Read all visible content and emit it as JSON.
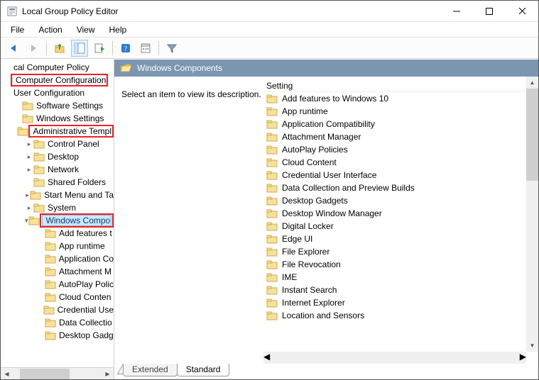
{
  "window": {
    "title": "Local Group Policy Editor"
  },
  "menus": [
    "File",
    "Action",
    "View",
    "Help"
  ],
  "toolbar_icons": [
    "back",
    "forward",
    "sep",
    "up",
    "treeview",
    "export",
    "sep",
    "help",
    "props",
    "sep",
    "filter"
  ],
  "tree": [
    {
      "indent": 0,
      "twist": "",
      "icon": "none",
      "label": "cal Computer Policy",
      "hl": false,
      "sel": false
    },
    {
      "indent": 0,
      "twist": "",
      "icon": "none",
      "label": "Computer Configuration",
      "hl": true,
      "sel": false
    },
    {
      "indent": 0,
      "twist": "",
      "icon": "none",
      "label": "User Configuration",
      "hl": false,
      "sel": false
    },
    {
      "indent": 1,
      "twist": "",
      "icon": "folder",
      "label": "Software Settings",
      "hl": false,
      "sel": false
    },
    {
      "indent": 1,
      "twist": "",
      "icon": "folder",
      "label": "Windows Settings",
      "hl": false,
      "sel": false
    },
    {
      "indent": 1,
      "twist": "",
      "icon": "folder",
      "label": "Administrative Templ",
      "hl": true,
      "sel": false
    },
    {
      "indent": 2,
      "twist": ">",
      "icon": "folder",
      "label": "Control Panel",
      "hl": false,
      "sel": false
    },
    {
      "indent": 2,
      "twist": ">",
      "icon": "folder",
      "label": "Desktop",
      "hl": false,
      "sel": false
    },
    {
      "indent": 2,
      "twist": ">",
      "icon": "folder",
      "label": "Network",
      "hl": false,
      "sel": false
    },
    {
      "indent": 2,
      "twist": "",
      "icon": "folder",
      "label": "Shared Folders",
      "hl": false,
      "sel": false
    },
    {
      "indent": 2,
      "twist": ">",
      "icon": "folder",
      "label": "Start Menu and Ta",
      "hl": false,
      "sel": false
    },
    {
      "indent": 2,
      "twist": ">",
      "icon": "folder",
      "label": "System",
      "hl": false,
      "sel": false
    },
    {
      "indent": 2,
      "twist": "v",
      "icon": "folder",
      "label": "Windows Compo",
      "hl": true,
      "sel": true
    },
    {
      "indent": 3,
      "twist": "",
      "icon": "folder",
      "label": "Add features t",
      "hl": false,
      "sel": false
    },
    {
      "indent": 3,
      "twist": "",
      "icon": "folder",
      "label": "App runtime",
      "hl": false,
      "sel": false
    },
    {
      "indent": 3,
      "twist": "",
      "icon": "folder",
      "label": "Application Co",
      "hl": false,
      "sel": false
    },
    {
      "indent": 3,
      "twist": "",
      "icon": "folder",
      "label": "Attachment M",
      "hl": false,
      "sel": false
    },
    {
      "indent": 3,
      "twist": "",
      "icon": "folder",
      "label": "AutoPlay Polic",
      "hl": false,
      "sel": false
    },
    {
      "indent": 3,
      "twist": "",
      "icon": "folder",
      "label": "Cloud Conten",
      "hl": false,
      "sel": false
    },
    {
      "indent": 3,
      "twist": "",
      "icon": "folder",
      "label": "Credential Use",
      "hl": false,
      "sel": false
    },
    {
      "indent": 3,
      "twist": "",
      "icon": "folder",
      "label": "Data Collectio",
      "hl": false,
      "sel": false
    },
    {
      "indent": 3,
      "twist": "",
      "icon": "folder",
      "label": "Desktop Gadg",
      "hl": false,
      "sel": false
    }
  ],
  "detail": {
    "header": "Windows Components",
    "desc": "Select an item to view its description.",
    "list_header": "Setting",
    "items": [
      "Add features to Windows 10",
      "App runtime",
      "Application Compatibility",
      "Attachment Manager",
      "AutoPlay Policies",
      "Cloud Content",
      "Credential User Interface",
      "Data Collection and Preview Builds",
      "Desktop Gadgets",
      "Desktop Window Manager",
      "Digital Locker",
      "Edge UI",
      "File Explorer",
      "File Revocation",
      "IME",
      "Instant Search",
      "Internet Explorer",
      "Location and Sensors"
    ]
  },
  "tabs": {
    "extended": "Extended",
    "standard": "Standard"
  }
}
